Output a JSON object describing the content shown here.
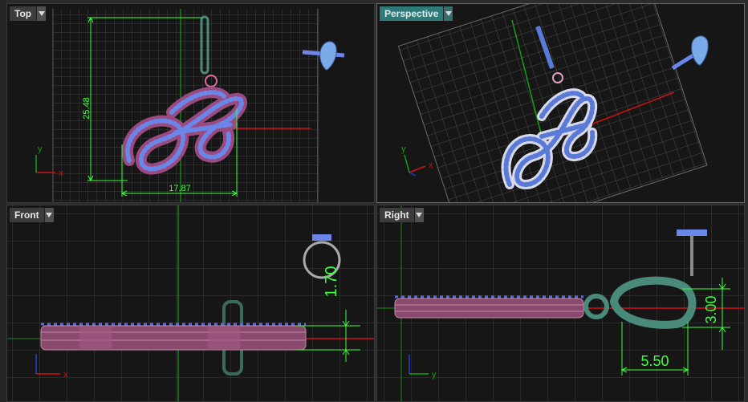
{
  "viewports": {
    "top": {
      "label": "Top"
    },
    "perspective": {
      "label": "Perspective"
    },
    "front": {
      "label": "Front"
    },
    "right": {
      "label": "Right"
    }
  },
  "dimensions": {
    "top_height": "25.48",
    "top_width": "17.87",
    "front_height": "1.70",
    "right_height": "3.00",
    "right_width": "5.50"
  },
  "axes": {
    "x": "x",
    "y": "y"
  },
  "colors": {
    "viewport_bg": "#161616",
    "grid_minor": "#3c3c3c",
    "grid_major": "#5a5a5a",
    "x_axis": "#d01010",
    "y_axis": "#10a010",
    "dimension": "#3cff3c",
    "metal": "#8a4a6e",
    "stone": "#6a86e8",
    "active_tab": "#2d7a7a"
  },
  "icons": {
    "viewport_menu": "chevron-down-icon"
  }
}
